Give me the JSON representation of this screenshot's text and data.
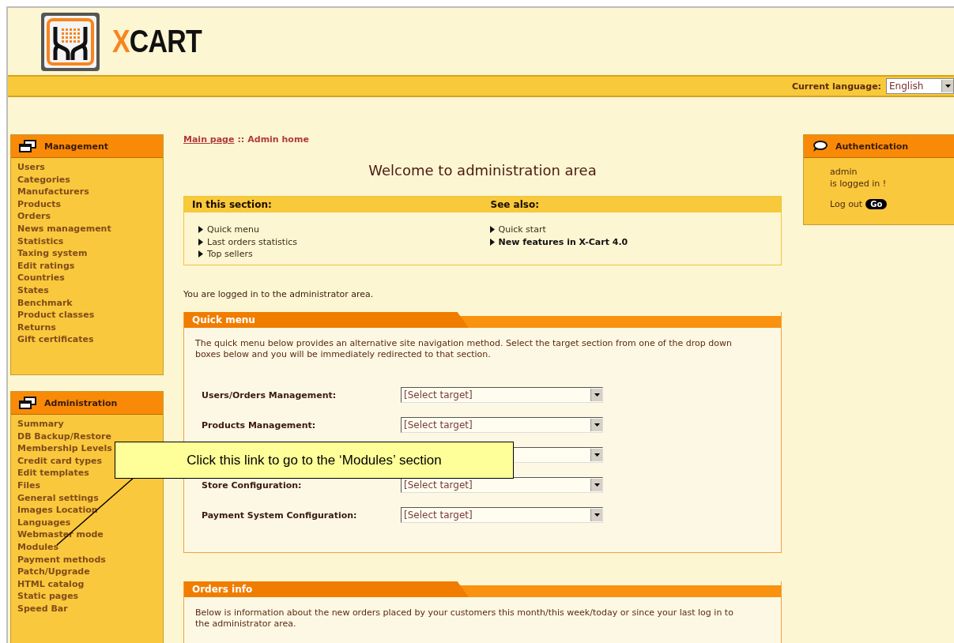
{
  "logo": {
    "accent": "X",
    "rest": "CART"
  },
  "language_bar": {
    "label": "Current language:",
    "value": "English"
  },
  "sidebar_boxes": [
    {
      "title": "Management",
      "items": [
        "Users",
        "Categories",
        "Manufacturers",
        "Products",
        "Orders",
        "News management",
        "Statistics",
        "Taxing system",
        "Edit ratings",
        "Countries",
        "States",
        "Benchmark",
        "Product classes",
        "Returns",
        "Gift certificates"
      ]
    },
    {
      "title": "Administration",
      "items": [
        "Summary",
        "DB Backup/Restore",
        "Membership Levels",
        "Credit card types",
        "Edit templates",
        "Files",
        "General settings",
        "Images Location",
        "Languages",
        "Webmaster mode",
        "Modules",
        "Payment methods",
        "Patch/Upgrade",
        "HTML catalog",
        "Static pages",
        "Speed Bar"
      ]
    }
  ],
  "breadcrumb": {
    "link": "Main page",
    "separator": "::",
    "current": "Admin home"
  },
  "page_title": "Welcome to administration area",
  "section_box": {
    "columns": [
      {
        "title": "In this section:",
        "links": [
          {
            "text": "Quick menu",
            "bold": false
          },
          {
            "text": "Last orders statistics",
            "bold": false
          },
          {
            "text": "Top sellers",
            "bold": false
          }
        ]
      },
      {
        "title": "See also:",
        "links": [
          {
            "text": "Quick start",
            "bold": false
          },
          {
            "text": "New features in X-Cart 4.0",
            "bold": true
          }
        ]
      }
    ]
  },
  "login_note": "You are logged in to the administrator area.",
  "quick_menu": {
    "title": "Quick menu",
    "intro": "The quick menu below provides an alternative site navigation method. Select the target section from one of the drop down boxes below and you will be immediately redirected to that section.",
    "rows": [
      {
        "label": "Users/Orders Management:",
        "value": "[Select target]"
      },
      {
        "label": "Products Management:",
        "value": "[Select target]"
      },
      {},
      {
        "label": "Store Configuration:",
        "value": "[Select target]"
      },
      {
        "label": "Payment System Configuration:",
        "value": "[Select target]"
      }
    ]
  },
  "orders_info": {
    "title": "Orders info",
    "intro": "Below is information about the new orders placed by your customers this month/this week/today or since your last log in to the administrator area."
  },
  "auth_box": {
    "title": "Authentication",
    "user": "admin",
    "status": "is logged in !",
    "logout_label": "Log out",
    "go_label": "Go"
  },
  "callout": {
    "text": "Click this link to go to the ‘Modules’ section"
  }
}
